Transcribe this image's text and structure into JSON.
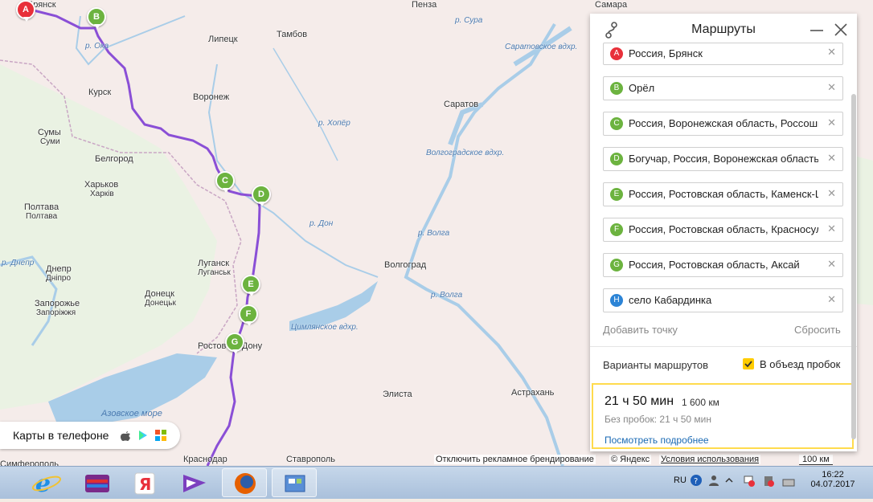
{
  "map": {
    "cities": [
      {
        "name": "Брянск"
      },
      {
        "name": "Пенза"
      },
      {
        "name": "Самара"
      },
      {
        "name": "Липецк"
      },
      {
        "name": "Тамбов"
      },
      {
        "name": "Курск"
      },
      {
        "name": "Воронеж"
      },
      {
        "name": "Саратов"
      },
      {
        "name": "Сумы"
      },
      {
        "name": "Суми"
      },
      {
        "name": "Белгород"
      },
      {
        "name": "Харьков"
      },
      {
        "name": "Харків"
      },
      {
        "name": "Полтава"
      },
      {
        "name": "Полтава"
      },
      {
        "name": "Днепр"
      },
      {
        "name": "Дніпро"
      },
      {
        "name": "Луганск"
      },
      {
        "name": "Луганськ"
      },
      {
        "name": "Волгоград"
      },
      {
        "name": "Донецк"
      },
      {
        "name": "Донецьк"
      },
      {
        "name": "Запорожье"
      },
      {
        "name": "Запоріжжя"
      },
      {
        "name": "Ростов-на-Дону"
      },
      {
        "name": "Элиста"
      },
      {
        "name": "Астрахань"
      },
      {
        "name": "Краснодар"
      },
      {
        "name": "Ставрополь"
      },
      {
        "name": "Симферополь"
      }
    ],
    "rivers": [
      "р. Сура",
      "Саратовское вдхр.",
      "р. Ока",
      "р. Хопёр",
      "Волгоградское вдхр.",
      "р. Дон",
      "р. Волга",
      "р. Волга",
      "Цимлянское вдхр.",
      "р. Днепр"
    ],
    "sea": "Азовское море",
    "markers": [
      "A",
      "B",
      "C",
      "D",
      "E",
      "F",
      "G"
    ]
  },
  "panel": {
    "title": "Маршруты",
    "waypoints": [
      {
        "letter": "A",
        "text": "Россия, Брянск",
        "color": "#e8303a"
      },
      {
        "letter": "B",
        "text": "Орёл",
        "color": "#6cb33f"
      },
      {
        "letter": "C",
        "text": "Россия, Воронежская область, Россошь",
        "color": "#6cb33f"
      },
      {
        "letter": "D",
        "text": "Богучар, Россия, Воронежская область",
        "color": "#6cb33f"
      },
      {
        "letter": "E",
        "text": "Россия, Ростовская область, Каменск-Шахтинский",
        "color": "#6cb33f"
      },
      {
        "letter": "F",
        "text": "Россия, Ростовская область, Красносулинский",
        "color": "#6cb33f"
      },
      {
        "letter": "G",
        "text": "Россия, Ростовская область, Аксай",
        "color": "#6cb33f"
      },
      {
        "letter": "H",
        "text": "село Кабардинка",
        "color": "#2c84d6"
      }
    ],
    "add_point": "Добавить точку",
    "reset": "Сбросить",
    "options_label": "Варианты маршрутов",
    "avoid_traffic": "В объезд пробок",
    "result": {
      "time": "21 ч 50 мин",
      "distance": "1 600 км",
      "no_traffic": "Без пробок: 21 ч 50 мин",
      "more": "Посмотреть подробнее"
    }
  },
  "phone_card": "Карты в телефоне",
  "copyright": {
    "disable_branding": "Отключить рекламное брендирование",
    "yandex": "© Яндекс",
    "terms": "Условия использования",
    "scale": "100 км"
  },
  "taskbar": {
    "lang": "RU",
    "time": "16:22",
    "date": "04.07.2017"
  },
  "colors": {
    "route": "#8a4fd6",
    "accent": "#ffcc00"
  }
}
